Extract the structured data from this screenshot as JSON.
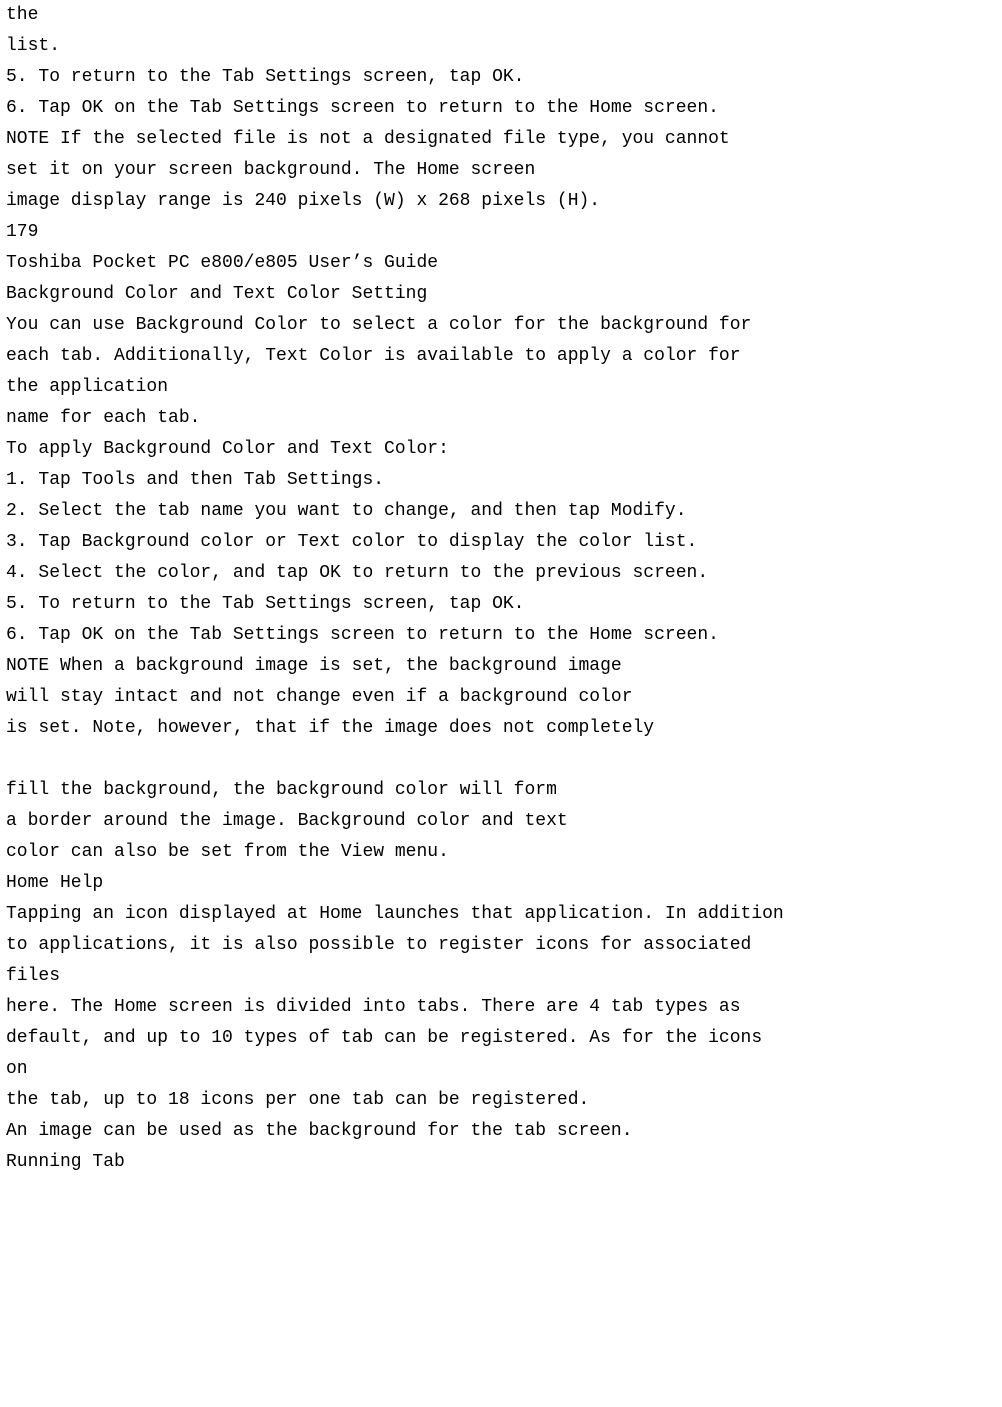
{
  "lines": [
    "the",
    "list.",
    "5. To return to the Tab Settings screen, tap OK.",
    "6. Tap OK on the Tab Settings screen to return to the Home screen.",
    "NOTE If the selected file is not a designated file type, you cannot",
    "set it on your screen background. The Home screen",
    "image display range is 240 pixels (W) x 268 pixels (H).",
    "179",
    "Toshiba Pocket PC e800/e805 User’s Guide",
    "Background Color and Text Color Setting",
    "You can use Background Color to select a color for the background for",
    "each tab. Additionally, Text Color is available to apply a color for",
    "the application",
    "name for each tab.",
    "To apply Background Color and Text Color:",
    "1. Tap Tools and then Tab Settings.",
    "2. Select the tab name you want to change, and then tap Modify.",
    "3. Tap Background color or Text color to display the color list.",
    "4. Select the color, and tap OK to return to the previous screen.",
    "5. To return to the Tab Settings screen, tap OK.",
    "6. Tap OK on the Tab Settings screen to return to the Home screen.",
    "NOTE When a background image is set, the background image",
    "will stay intact and not change even if a background color",
    "is set. Note, however, that if the image does not completely",
    "",
    "fill the background, the background color will form",
    "a border around the image. Background color and text",
    "color can also be set from the View menu.",
    "Home Help",
    "Tapping an icon displayed at Home launches that application. In addition",
    "to applications, it is also possible to register icons for associated",
    "files",
    "here. The Home screen is divided into tabs. There are 4 tab types as",
    "default, and up to 10 types of tab can be registered. As for the icons",
    "on",
    "the tab, up to 18 icons per one tab can be registered.",
    "An image can be used as the background for the tab screen.",
    "Running Tab"
  ]
}
